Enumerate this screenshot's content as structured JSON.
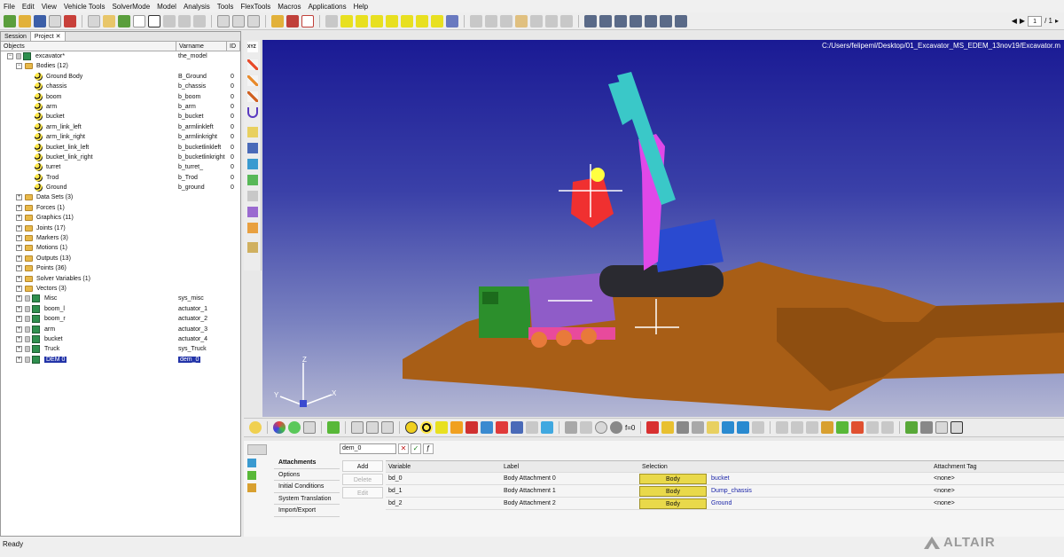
{
  "menu": [
    "File",
    "Edit",
    "View",
    "Vehicle Tools",
    "SolverMode",
    "Model",
    "Analysis",
    "Tools",
    "FlexTools",
    "Macros",
    "Applications",
    "Help"
  ],
  "pager": {
    "page": "1",
    "of": "/ 1"
  },
  "browser": {
    "tabs": [
      "Session",
      "Project"
    ],
    "headers": {
      "objects": "Objects",
      "varname": "Varname",
      "id": "ID"
    },
    "root": {
      "name": "excavator*",
      "varname": "the_model"
    },
    "bodies_folder": "Bodies (12)",
    "bodies": [
      {
        "name": "Ground Body",
        "varname": "B_Ground",
        "id": "0"
      },
      {
        "name": "chassis",
        "varname": "b_chassis",
        "id": "0"
      },
      {
        "name": "boom",
        "varname": "b_boom",
        "id": "0"
      },
      {
        "name": "arm",
        "varname": "b_arm",
        "id": "0"
      },
      {
        "name": "bucket",
        "varname": "b_bucket",
        "id": "0"
      },
      {
        "name": "arm_link_left",
        "varname": "b_armlinkleft",
        "id": "0"
      },
      {
        "name": "arm_link_right",
        "varname": "b_armlinkright",
        "id": "0"
      },
      {
        "name": "bucket_link_left",
        "varname": "b_bucketlinkleft",
        "id": "0"
      },
      {
        "name": "bucket_link_right",
        "varname": "b_bucketlinkright",
        "id": "0"
      },
      {
        "name": "turret",
        "varname": "b_turret_",
        "id": "0"
      },
      {
        "name": "Trod",
        "varname": "b_Trod",
        "id": "0"
      },
      {
        "name": "Ground",
        "varname": "b_ground",
        "id": "0"
      }
    ],
    "folders": [
      "Data Sets (3)",
      "Forces (1)",
      "Graphics (11)",
      "Joints (17)",
      "Markers (3)",
      "Motions (1)",
      "Outputs (13)",
      "Points (36)",
      "Solver Variables (1)",
      "Vectors (3)"
    ],
    "systems": [
      {
        "name": "Misc",
        "varname": "sys_misc"
      },
      {
        "name": "boom_l",
        "varname": "actuator_1"
      },
      {
        "name": "boom_r",
        "varname": "actuator_2"
      },
      {
        "name": "arm",
        "varname": "actuator_3"
      },
      {
        "name": "bucket",
        "varname": "actuator_4"
      },
      {
        "name": "Truck",
        "varname": "sys_Truck"
      },
      {
        "name": "DEM 0",
        "varname": "dem_0"
      }
    ]
  },
  "viewport": {
    "path": "C:/Users/felipeml/Desktop/01_Excavator_MS_EDEM_13nov19/Excavator.m",
    "axes": {
      "x": "X",
      "y": "Y",
      "z": "Z"
    }
  },
  "vtoolbar": {
    "xyz": "XYZ"
  },
  "panel": {
    "entity": "dem_0",
    "nav": [
      "Attachments",
      "Options",
      "Initial Conditions",
      "System Translation",
      "Import/Export"
    ],
    "actions": [
      "Add",
      "Delete",
      "Edit"
    ],
    "columns": {
      "variable": "Variable",
      "label": "Label",
      "selection": "Selection",
      "tag": "Attachment Tag"
    },
    "rows": [
      {
        "variable": "bd_0",
        "label": "Body Attachment 0",
        "type": "Body",
        "selection": "bucket",
        "tag": "<none>"
      },
      {
        "variable": "bd_1",
        "label": "Body Attachment 1",
        "type": "Body",
        "selection": "Dump_chassis",
        "tag": "<none>"
      },
      {
        "variable": "bd_2",
        "label": "Body Attachment 2",
        "type": "Body",
        "selection": "Ground",
        "tag": "<none>"
      }
    ]
  },
  "status": "Ready",
  "logo": "ALTAIR",
  "f0": "f=0"
}
